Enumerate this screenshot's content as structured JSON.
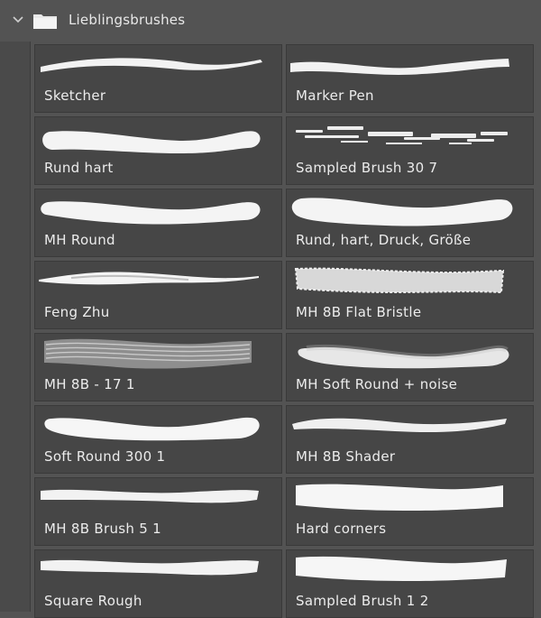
{
  "folder": {
    "title": "Lieblingsbrushes",
    "expand_icon": "chevron-down-icon",
    "folder_icon": "folder-icon"
  },
  "brushes": [
    {
      "name": "Sketcher"
    },
    {
      "name": "Marker Pen"
    },
    {
      "name": "Rund hart"
    },
    {
      "name": "Sampled Brush 30 7"
    },
    {
      "name": "MH Round"
    },
    {
      "name": "Rund, hart, Druck, Größe"
    },
    {
      "name": "Feng Zhu"
    },
    {
      "name": "MH 8B Flat Bristle"
    },
    {
      "name": "MH 8B - 17 1"
    },
    {
      "name": "MH Soft Round + noise"
    },
    {
      "name": "Soft Round 300 1"
    },
    {
      "name": "MH 8B Shader"
    },
    {
      "name": "MH 8B Brush 5 1"
    },
    {
      "name": "Hard corners"
    },
    {
      "name": "Square Rough"
    },
    {
      "name": "Sampled Brush 1 2"
    }
  ]
}
